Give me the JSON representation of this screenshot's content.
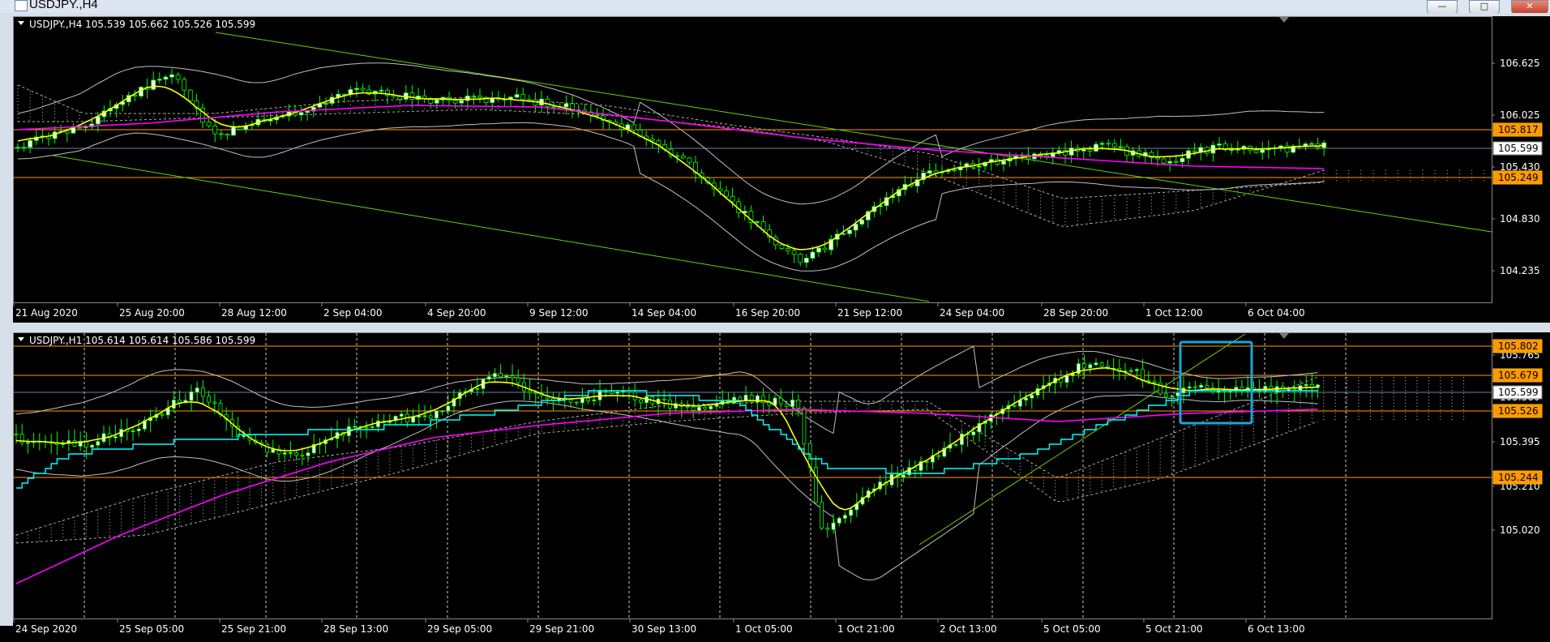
{
  "window": {
    "title": "USDJPY.,H4"
  },
  "top_chart": {
    "header": "USDJPY.,H4  105.539 105.662 105.526 105.599",
    "price_labels": [
      "106.625",
      "106.025",
      "105.430",
      "104.830",
      "104.235"
    ],
    "markers": [
      {
        "text": "105.817",
        "kind": "orange"
      },
      {
        "text": "105.599",
        "kind": "white"
      },
      {
        "text": "105.249",
        "kind": "orange"
      }
    ],
    "time_labels": [
      "21 Aug 2020",
      "25 Aug 20:00",
      "28 Aug 12:00",
      "2 Sep 04:00",
      "4 Sep 20:00",
      "9 Sep 12:00",
      "14 Sep 04:00",
      "16 Sep 20:00",
      "21 Sep 12:00",
      "24 Sep 04:00",
      "28 Sep 20:00",
      "1 Oct 12:00",
      "6 Oct 04:00"
    ]
  },
  "bottom_chart": {
    "header": "USDJPY.,H1  105.614 105.614 105.586 105.599",
    "price_labels": [
      "105.765",
      "105.580",
      "105.395",
      "105.210",
      "105.020"
    ],
    "markers": [
      {
        "text": "105.802",
        "kind": "orange"
      },
      {
        "text": "105.679",
        "kind": "orange"
      },
      {
        "text": "105.599",
        "kind": "white"
      },
      {
        "text": "105.526",
        "kind": "orange"
      },
      {
        "text": "105.244",
        "kind": "orange"
      }
    ],
    "time_labels": [
      "24 Sep 2020",
      "25 Sep 05:00",
      "25 Sep 21:00",
      "28 Sep 13:00",
      "29 Sep 05:00",
      "29 Sep 21:00",
      "30 Sep 13:00",
      "1 Oct 05:00",
      "1 Oct 21:00",
      "2 Oct 13:00",
      "5 Oct 05:00",
      "5 Oct 21:00",
      "6 Oct 13:00"
    ]
  },
  "colors": {
    "candle": "#00ff00",
    "ma_yellow": "#ffff00",
    "ma_magenta": "#ff00ff",
    "kijun_cyan": "#00ffff",
    "bollinger": "#c0c0c0",
    "level_orange": "#ff9900",
    "level_blue": "#6a82a0",
    "trendline": "#6bd000",
    "highlight_box": "#1fa3d8"
  }
}
